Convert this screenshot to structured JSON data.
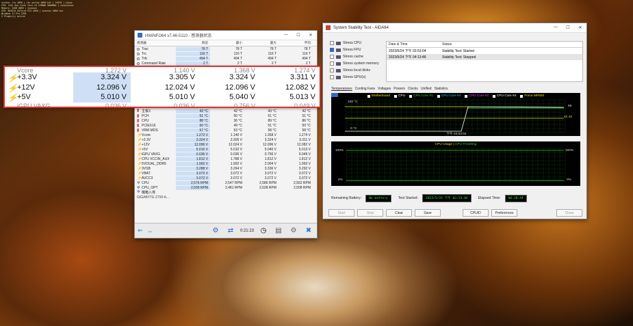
{
  "overlay": [
    "nvidia: rtx 4090 | rtx series 4090 bit | 24576 | xxxxx",
    "CPU: 13th Gen Intel Core i9 13900K 5800MHz | xxxxxxxxxx",
    "Memory: 32GB DDR5 | xxxxxxx",
    "GPU: NVIDIA GeForce RTX 4090 | xxxxxxx 4090 xxx",
    "Windows 11 Pro 22H2",
    "5 Plugin(s) active"
  ],
  "hwinfo": {
    "title": "HWiNFO64 v7.46-5110 - 感测器状态",
    "columns": [
      "感测器",
      "目前",
      "最小",
      "最大",
      "平均"
    ],
    "rows_top": [
      {
        "name": "Trac",
        "cur": "78 T",
        "min": "78 T",
        "max": "78 T",
        "avg": "78 T",
        "icon": "dot"
      },
      {
        "name": "Trc",
        "cur": "116 T",
        "min": "116 T",
        "max": "116 T",
        "avg": "116 T",
        "icon": "dot"
      },
      {
        "name": "Trfc",
        "cur": "494 T",
        "min": "494 T",
        "max": "494 T",
        "avg": "494 T",
        "icon": "dot"
      },
      {
        "name": "Command Rate",
        "cur": "2 T",
        "min": "2 T",
        "max": "2 T",
        "avg": "2 T",
        "icon": "dot"
      }
    ],
    "group1": "GIGABYTE Z790 A...",
    "rows": [
      {
        "name": "主板3",
        "cur": "42 °C",
        "min": "42 °C",
        "max": "43 °C",
        "avg": "42 °C",
        "icon": "therm"
      },
      {
        "name": "PCH",
        "cur": "51 °C",
        "min": "50 °C",
        "max": "51 °C",
        "avg": "51 °C",
        "icon": "therm"
      },
      {
        "name": "CPU",
        "cur": "88 °C",
        "min": "36 °C",
        "max": "89 °C",
        "avg": "86 °C",
        "icon": "therm"
      },
      {
        "name": "PCIEX16",
        "cur": "50 °C",
        "min": "49 °C",
        "max": "51 °C",
        "avg": "50 °C",
        "icon": "therm"
      },
      {
        "name": "VRM MOS",
        "cur": "57 °C",
        "min": "53 °C",
        "max": "58 °C",
        "avg": "58 °C",
        "icon": "therm"
      },
      {
        "name": "Vcore",
        "cur": "1.272 V",
        "min": "1.140 V",
        "max": "1.368 V",
        "avg": "1.274 V",
        "icon": "bolt"
      },
      {
        "name": "+3.3V",
        "cur": "3.324 V",
        "min": "3.305 V",
        "max": "3.324 V",
        "avg": "3.311 V",
        "icon": "bolt"
      },
      {
        "name": "+12V",
        "cur": "12.096 V",
        "min": "12.024 V",
        "max": "12.096 V",
        "avg": "12.082 V",
        "icon": "bolt"
      },
      {
        "name": "+5V",
        "cur": "5.010 V",
        "min": "5.010 V",
        "max": "5.040 V",
        "avg": "5.013 V",
        "icon": "bolt"
      },
      {
        "name": "iGPU VAXG",
        "cur": "0.036 V",
        "min": "0.036 V",
        "max": "0.756 V",
        "avg": "0.049 V",
        "icon": "bolt"
      },
      {
        "name": "CPU VCCIN_AUX",
        "cur": "1.812 V",
        "min": "1.788 V",
        "max": "1.812 V",
        "avg": "1.812 V",
        "icon": "bolt"
      },
      {
        "name": "5VDUAL_DDR5",
        "cur": "1.992 V",
        "min": "1.992 V",
        "max": "2.004 V",
        "avg": "1.993 V",
        "icon": "bolt"
      },
      {
        "name": "3VSB",
        "cur": "3.288 V",
        "min": "3.264 V",
        "max": "3.336 V",
        "avg": "3.292 V",
        "icon": "bolt"
      },
      {
        "name": "VBAT",
        "cur": "3.072 V",
        "min": "3.072 V",
        "max": "3.072 V",
        "avg": "3.072 V",
        "icon": "bolt"
      },
      {
        "name": "AVCC3",
        "cur": "3.072 V",
        "min": "3.072 V",
        "max": "3.072 V",
        "avg": "3.072 V",
        "icon": "bolt"
      },
      {
        "name": "CPU",
        "cur": "2,576 RPM",
        "min": "2,547 RPM",
        "max": "2,586 RPM",
        "avg": "2,562 RPM",
        "icon": "fan"
      },
      {
        "name": "CPU_OPT",
        "cur": "2,509 RPM",
        "min": "2,481 RPM",
        "max": "2,528 RPM",
        "avg": "2,508 RPM",
        "icon": "fan"
      },
      {
        "name": "機箱入埠",
        "cur": "",
        "min": "",
        "max": "",
        "avg": "",
        "icon": "fan"
      }
    ],
    "group2": "GIGABYTE Z790 A...",
    "time": "0:21:23"
  },
  "zoom": {
    "rows": [
      {
        "name": "+3.3V",
        "cur": "3.324 V",
        "min": "3.305 V",
        "max": "3.324 V",
        "avg": "3.311 V"
      },
      {
        "name": "+12V",
        "cur": "12.096 V",
        "min": "12.024 V",
        "max": "12.096 V",
        "avg": "12.082 V"
      },
      {
        "name": "+5V",
        "cur": "5.010 V",
        "min": "5.010 V",
        "max": "5.040 V",
        "avg": "5.013 V"
      }
    ]
  },
  "aida": {
    "title": "System Stability Test - AIDA64",
    "stress": [
      {
        "label": "Stress CPU",
        "checked": false
      },
      {
        "label": "Stress FPU",
        "checked": true
      },
      {
        "label": "Stress cache",
        "checked": false
      },
      {
        "label": "Stress system memory",
        "checked": false
      },
      {
        "label": "Stress local disks",
        "checked": false
      },
      {
        "label": "Stress GPU(s)",
        "checked": false
      }
    ],
    "status_head": [
      "Date & Time",
      "Status"
    ],
    "status_rows": [
      {
        "dt": "2023/5/24 下午 03:53:04",
        "status": "Stability Test: Started"
      },
      {
        "dt": "2023/5/24 下午 04:13:48",
        "status": "Stability Test: Stopped"
      }
    ],
    "tabs": [
      "Temperatures",
      "Cooling Fans",
      "Voltages",
      "Powers",
      "Clocks",
      "Unified",
      "Statistics"
    ],
    "legend": [
      {
        "label": "Motherboard",
        "color": "#e8e800"
      },
      {
        "label": "CPU",
        "color": "#ffffff"
      },
      {
        "label": "CPU Core #1",
        "color": "#2dd72d"
      },
      {
        "label": "CPU Core #2",
        "color": "#2dc8ff"
      },
      {
        "label": "CPU Core #3",
        "color": "#ff40ff"
      },
      {
        "label": "CPU Core #4",
        "color": "#ffffff"
      },
      {
        "label": "Force MP600",
        "color": "#e8e800"
      }
    ],
    "g1_top": "100 °C",
    "g1_bot": "0 °C",
    "g1_time": "下午 03:53:04",
    "g1_right1": "85",
    "g1_right2": "42 42",
    "g2_title_a": "CPU Usage",
    "g2_sep": "|",
    "g2_title_b": "CPU Throttling",
    "g2_top_l": "100%",
    "g2_bot_l": "0%",
    "g2_top_r": "100%",
    "g2_bot_r": "0%",
    "remaining_label": "Remaining Battery:",
    "remaining_val": "No battery",
    "started_label": "Test Started:",
    "started_val": "2023/5/24 下午 03:53:04",
    "elapsed_label": "Elapsed Time:",
    "elapsed_val": "00:20:44",
    "buttons": [
      "Start",
      "Stop",
      "Clear",
      "Save",
      "CPUID",
      "Preferences",
      "Close"
    ]
  }
}
